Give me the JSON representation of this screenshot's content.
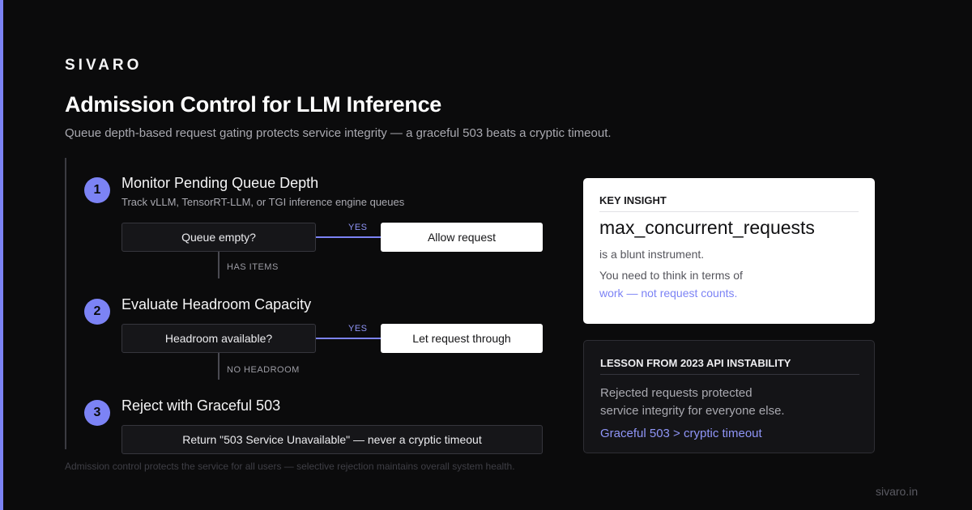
{
  "brand": "SIVARO",
  "title": "Admission Control for LLM Inference",
  "subtitle": "Queue depth-based request gating protects service integrity — a graceful 503 beats a cryptic timeout.",
  "steps": [
    {
      "number": "1",
      "title": "Monitor Pending Queue Depth",
      "description": "Track vLLM, TensorRT-LLM, or TGI inference engine queues",
      "decision": "Queue empty?",
      "yes_label": "YES",
      "yes_action": "Allow request",
      "no_label": "HAS ITEMS"
    },
    {
      "number": "2",
      "title": "Evaluate Headroom Capacity",
      "decision": "Headroom available?",
      "yes_label": "YES",
      "yes_action": "Let request through",
      "no_label": "NO HEADROOM"
    },
    {
      "number": "3",
      "title": "Reject with Graceful 503",
      "action": "Return \"503 Service Unavailable\" — never a cryptic timeout"
    }
  ],
  "footnote": "Admission control protects the service for all users — selective rejection maintains overall system health.",
  "insight": {
    "heading": "KEY INSIGHT",
    "main": "max_concurrent_requests",
    "line1": "is a blunt instrument.",
    "line2": "You need to think in terms of",
    "line3": "work — not request counts."
  },
  "lesson": {
    "heading": "LESSON FROM 2023 API INSTABILITY",
    "line1": "Rejected requests protected",
    "line2": "service integrity for everyone else.",
    "link": "Graceful 503 > cryptic timeout"
  },
  "site": "sivaro.in",
  "colors": {
    "accent": "#7c83f5",
    "background": "#0b0b0c",
    "card_light": "#ffffff",
    "card_dark": "#141417"
  }
}
